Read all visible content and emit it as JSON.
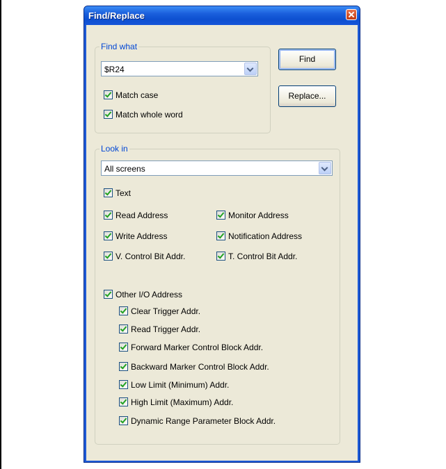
{
  "window": {
    "title": "Find/Replace"
  },
  "find_what": {
    "legend": "Find what",
    "value": "$R24",
    "match_case": "Match case",
    "match_whole_word": "Match whole word"
  },
  "buttons": {
    "find": "Find",
    "replace": "Replace..."
  },
  "look_in": {
    "legend": "Look in",
    "scope": "All screens",
    "text": "Text",
    "read_address": "Read Address",
    "monitor_address": "Monitor Address",
    "write_address": "Write Address",
    "notification_address": "Notification Address",
    "v_control": "V. Control Bit Addr.",
    "t_control": "T. Control Bit Addr.",
    "other_io": "Other I/O Address",
    "other_items": [
      "Clear Trigger Addr.",
      "Read Trigger Addr.",
      "Forward Marker Control Block Addr.",
      "Backward Marker Control Block Addr.",
      "Low Limit (Minimum) Addr.",
      "High Limit (Maximum) Addr.",
      "Dynamic Range Parameter Block Addr."
    ]
  }
}
